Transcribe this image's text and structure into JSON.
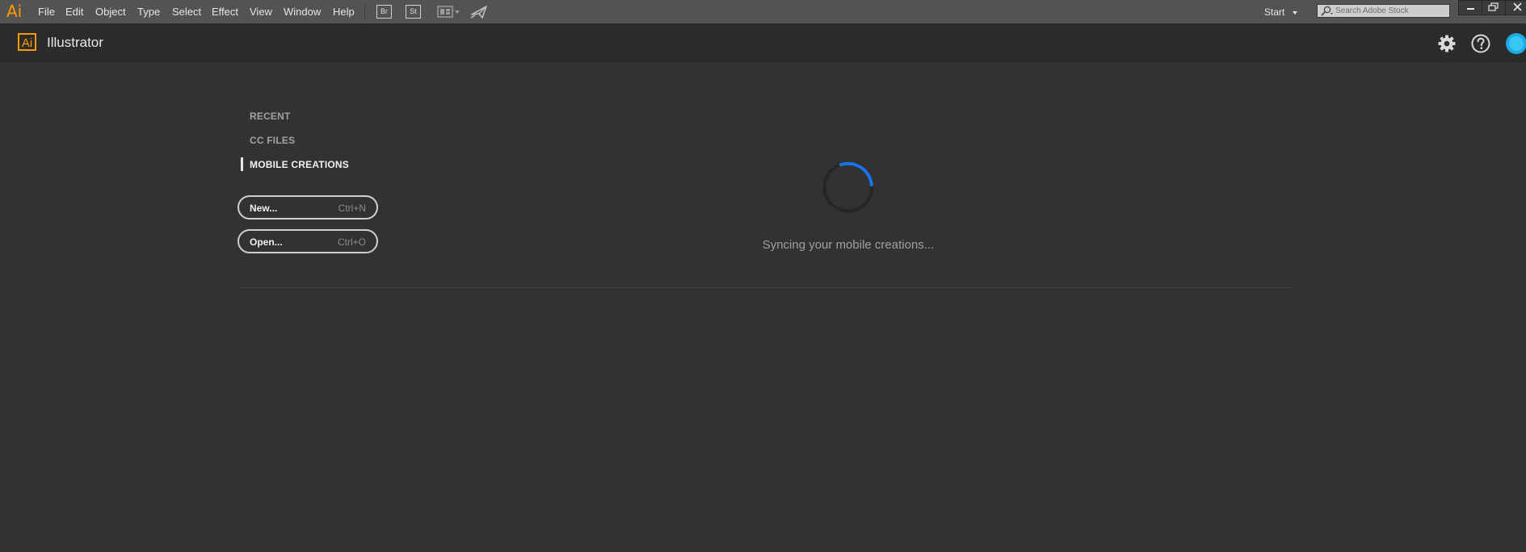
{
  "menubar": {
    "logo_text": "Ai",
    "items": [
      "File",
      "Edit",
      "Object",
      "Type",
      "Select",
      "Effect",
      "View",
      "Window",
      "Help"
    ],
    "bridge_badge": "Br",
    "stock_badge": "St",
    "arrange_icon": "arrange-documents-icon",
    "send_icon": "gpu-performance-icon",
    "workspace_label": "Start",
    "search_placeholder": "Search Adobe Stock"
  },
  "titlebar": {
    "logo_text": "Ai",
    "app_name": "Illustrator",
    "icons": [
      "gear-icon",
      "help-icon",
      "creative-cloud-icon"
    ]
  },
  "start": {
    "nav": [
      {
        "label": "RECENT",
        "active": false
      },
      {
        "label": "CC FILES",
        "active": false
      },
      {
        "label": "MOBILE CREATIONS",
        "active": true
      }
    ],
    "new_button": {
      "label": "New...",
      "shortcut": "Ctrl+N"
    },
    "open_button": {
      "label": "Open...",
      "shortcut": "Ctrl+O"
    },
    "status_text": "Syncing your mobile creations...",
    "spinner_color": "#1a73e8"
  },
  "colors": {
    "accent": "#ff9a00",
    "background": "#323232",
    "menubar": "#535353",
    "titlebar": "#2b2b2b"
  }
}
